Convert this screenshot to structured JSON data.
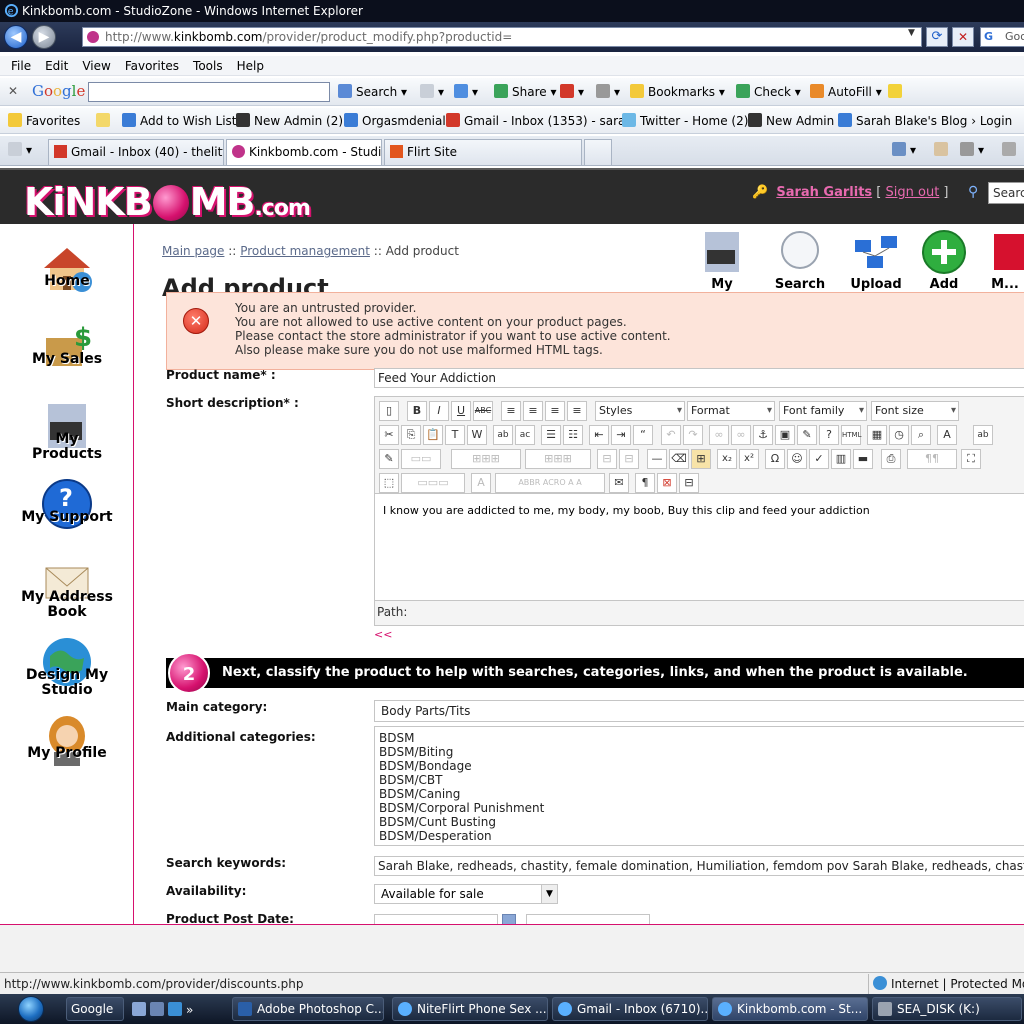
{
  "window": {
    "title": "Kinkbomb.com - StudioZone - Windows Internet Explorer"
  },
  "address_bar": {
    "url_prefix": "http://www.",
    "url_host": "kinkbomb.com",
    "url_path": "/provider/product_modify.php?productid=",
    "search_placeholder": "Goo"
  },
  "menu": [
    "File",
    "Edit",
    "View",
    "Favorites",
    "Tools",
    "Help"
  ],
  "google_toolbar": {
    "logo": "Google",
    "search_label": "Search",
    "share_label": "Share",
    "bookmarks_label": "Bookmarks",
    "check_label": "Check",
    "autofill_label": "AutoFill"
  },
  "favorites_bar": {
    "favorites_label": "Favorites",
    "items": [
      "Add to Wish List",
      "New Admin (2)",
      "Orgasmdenial",
      "Gmail - Inbox (1353) - sara...",
      "Twitter - Home (2)",
      "New Admin",
      "Sarah Blake's Blog › Login"
    ]
  },
  "tabs": [
    {
      "label": "Gmail - Inbox (40) - thelittl...",
      "active": false
    },
    {
      "label": "Kinkbomb.com - Studi...",
      "active": true
    },
    {
      "label": "Flirt Site",
      "active": false
    }
  ],
  "site": {
    "logo_left": "KiNKB",
    "logo_right": "MB",
    "logo_dotcom": ".com",
    "user_name": "Sarah Garlits",
    "signout": "Sign out",
    "search_placeholder": "Searc"
  },
  "sidebar": [
    {
      "label": "Home"
    },
    {
      "label": "My Sales"
    },
    {
      "label": "My Products"
    },
    {
      "label": "My Support"
    },
    {
      "label": "My Address Book"
    },
    {
      "label": "Design My Studio"
    },
    {
      "label": "My Profile"
    }
  ],
  "breadcrumb": {
    "main": "Main page",
    "sep": "::",
    "product_mgmt": "Product management",
    "current": "Add product"
  },
  "page_title": "Add product",
  "action_buttons": [
    {
      "label": "My Products"
    },
    {
      "label": "Search Products"
    },
    {
      "label": "Upload Files"
    },
    {
      "label": "Add Product"
    },
    {
      "label": "M... Disco"
    }
  ],
  "error": {
    "lines": [
      "You are an untrusted provider.",
      "You are not allowed to use active content on your product pages.",
      "Please contact the store administrator if you want to use active content.",
      "Also please make sure you do not use malformed HTML tags."
    ]
  },
  "form": {
    "product_name_label": "Product name* :",
    "product_name_value": "Feed Your Addiction",
    "short_desc_label": "Short description* :",
    "editor": {
      "styles": "Styles",
      "format": "Format",
      "font_family": "Font family",
      "font_size": "Font size",
      "content": "I know you are addicted to me, my body, my boob, Buy this clip and feed your addiction",
      "path_label": "Path:",
      "collapse": "<<"
    },
    "step2": {
      "number": "2",
      "text": "Next, classify the product to help with searches, categories, links, and when the product is available."
    },
    "main_category_label": "Main category:",
    "main_category_value": "Body Parts/Tits",
    "additional_categories_label": "Additional categories:",
    "additional_categories": [
      "BDSM",
      "BDSM/Biting",
      "BDSM/Bondage",
      "BDSM/CBT",
      "BDSM/Caning",
      "BDSM/Corporal Punishment",
      "BDSM/Cunt Busting",
      "BDSM/Desperation"
    ],
    "search_keywords_label": "Search keywords:",
    "search_keywords_value": "Sarah Blake, redheads, chastity, female domination, Humiliation, femdom pov  Sarah Blake, redheads, chastity, female",
    "availability_label": "Availability:",
    "availability_value": "Available for sale",
    "post_date_label": "Product Post Date:"
  },
  "status_bar": {
    "url": "http://www.kinkbomb.com/provider/discounts.php",
    "zone": "Internet | Protected Mode"
  },
  "taskbar": {
    "items": [
      {
        "label": "Google",
        "active": false
      },
      {
        "label": "Adobe Photoshop C...",
        "active": false
      },
      {
        "label": "NiteFlirt Phone Sex ...",
        "active": false
      },
      {
        "label": "Gmail - Inbox (6710)...",
        "active": false
      },
      {
        "label": "Kinkbomb.com - St...",
        "active": true
      },
      {
        "label": "SEA_DISK (K:)",
        "active": false
      }
    ]
  }
}
